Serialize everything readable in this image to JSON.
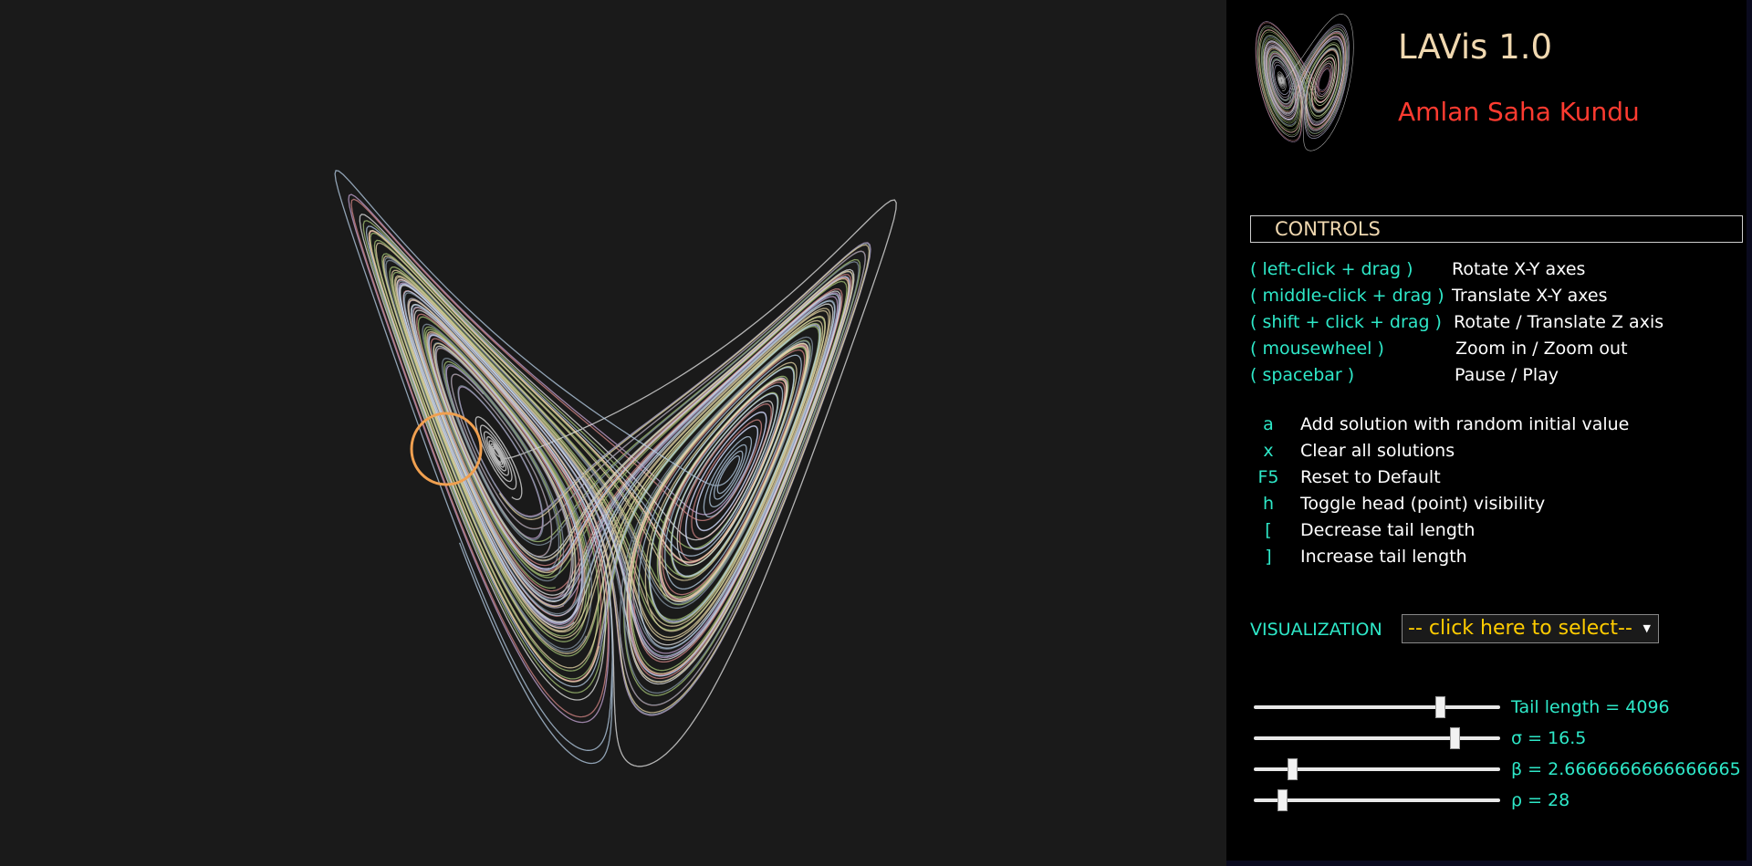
{
  "app": {
    "title": "LAVis 1.0",
    "author": "Amlan Saha Kundu"
  },
  "controls": {
    "heading": "CONTROLS",
    "mouse": [
      {
        "key": "( left-click + drag )",
        "desc": "Rotate X-Y axes"
      },
      {
        "key": "( middle-click + drag )",
        "desc": "Translate X-Y axes"
      },
      {
        "key": "( shift + click + drag )",
        "desc": "Rotate / Translate Z axis"
      },
      {
        "key": "( mousewheel )",
        "desc": "Zoom in / Zoom out"
      },
      {
        "key": "( spacebar )",
        "desc": "Pause / Play"
      }
    ],
    "keys": [
      {
        "key": "a",
        "desc": "Add solution with random initial value"
      },
      {
        "key": "x",
        "desc": "Clear all solutions"
      },
      {
        "key": "F5",
        "desc": "Reset to Default"
      },
      {
        "key": "h",
        "desc": "Toggle head (point) visibility"
      },
      {
        "key": "[",
        "desc": "Decrease tail length"
      },
      {
        "key": "]",
        "desc": "Increase tail length"
      }
    ]
  },
  "visualization": {
    "label": "VISUALIZATION",
    "selected": "-- click here to select--"
  },
  "sliders": [
    {
      "name": "tail-length",
      "label": "Tail length = 4096",
      "fraction": 0.76
    },
    {
      "name": "sigma",
      "label": "σ = 16.5",
      "fraction": 0.82
    },
    {
      "name": "beta",
      "label": "β = 2.6666666666666665",
      "fraction": 0.14
    },
    {
      "name": "rho",
      "label": "ρ = 28",
      "fraction": 0.1
    }
  ],
  "colors": {
    "accent": "#2ee8c8",
    "title": "#f0d8b0",
    "author": "#ff3b30",
    "select_text": "#ffcc00",
    "trajectory_palette": [
      "#c8a8d8",
      "#a8c878",
      "#d88888",
      "#e8e8e8",
      "#8898a8",
      "#e8d8a8",
      "#b8d0e8"
    ],
    "head_ring": "#f0a050"
  }
}
